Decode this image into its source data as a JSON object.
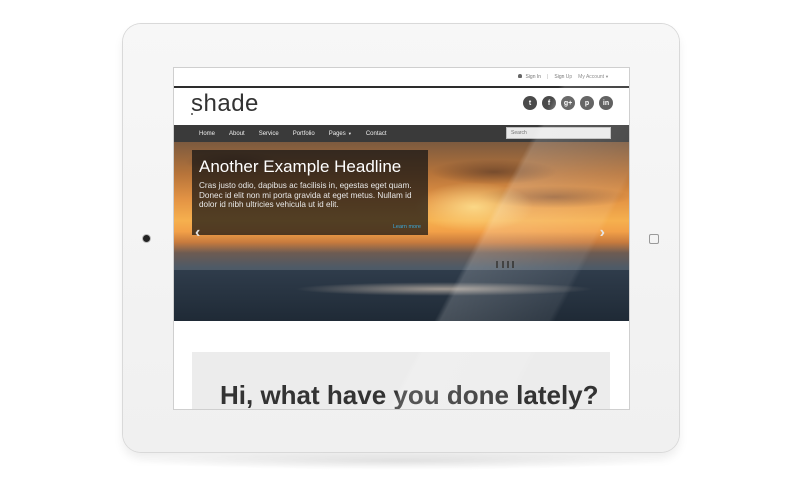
{
  "topbar": {
    "sign_in": "Sign In",
    "separator": "|",
    "sign_up": "Sign Up",
    "my_account": "My Account"
  },
  "brand": {
    "logo": "shade"
  },
  "social": [
    {
      "icon": "twitter-icon",
      "glyph": "t"
    },
    {
      "icon": "facebook-icon",
      "glyph": "f"
    },
    {
      "icon": "google-plus-icon",
      "glyph": "g+"
    },
    {
      "icon": "pinterest-icon",
      "glyph": "p"
    },
    {
      "icon": "linkedin-icon",
      "glyph": "in"
    }
  ],
  "nav": {
    "items": [
      "Home",
      "About",
      "Service",
      "Portfolio",
      "Pages",
      "Contact"
    ],
    "search_placeholder": "Search"
  },
  "hero": {
    "headline": "Another Example Headline",
    "body": "Cras justo odio, dapibus ac facilisis in, egestas eget quam. Donec id elit non mi porta gravida at eget metus. Nullam id dolor id nibh ultricies vehicula ut id elit.",
    "link": "Learn more",
    "prev": "‹",
    "next": "›"
  },
  "welcome": {
    "title": "Hi, what have you done lately?"
  },
  "colors": {
    "nav_bg": "#3a3a3a",
    "link_accent": "#3aa8d8",
    "caption_bg": "#141414"
  }
}
